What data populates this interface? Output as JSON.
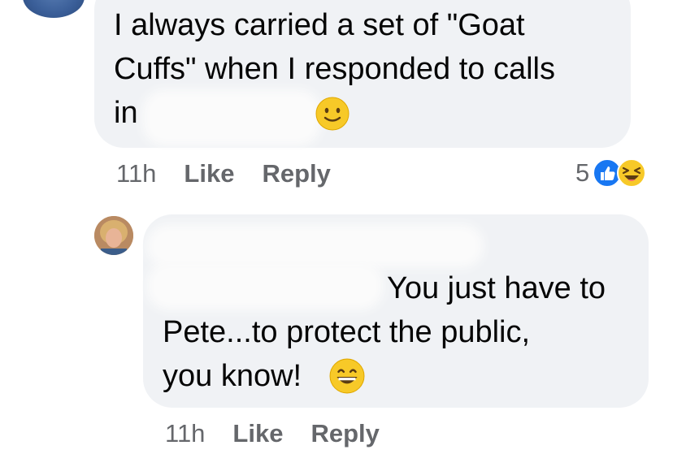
{
  "comment1": {
    "text_line1": "I always carried a set of \"Goat",
    "text_line2": "Cuffs\" when I responded to calls",
    "text_line3": "in",
    "emoji": "slightly-smiling-face",
    "time": "11h",
    "like": "Like",
    "reply": "Reply",
    "reaction_count": "5",
    "reactions": [
      "like",
      "haha"
    ]
  },
  "comment2": {
    "text_line1": "You just have to",
    "text_line2": "Pete...to protect the public,",
    "text_line3": "you know!",
    "emoji": "grinning-face",
    "time": "11h",
    "like": "Like",
    "reply": "Reply"
  },
  "colors": {
    "bubble": "#f0f2f5",
    "meta": "#65676b",
    "like_blue": "#1877f2",
    "emoji_yellow": "#f7c928"
  }
}
